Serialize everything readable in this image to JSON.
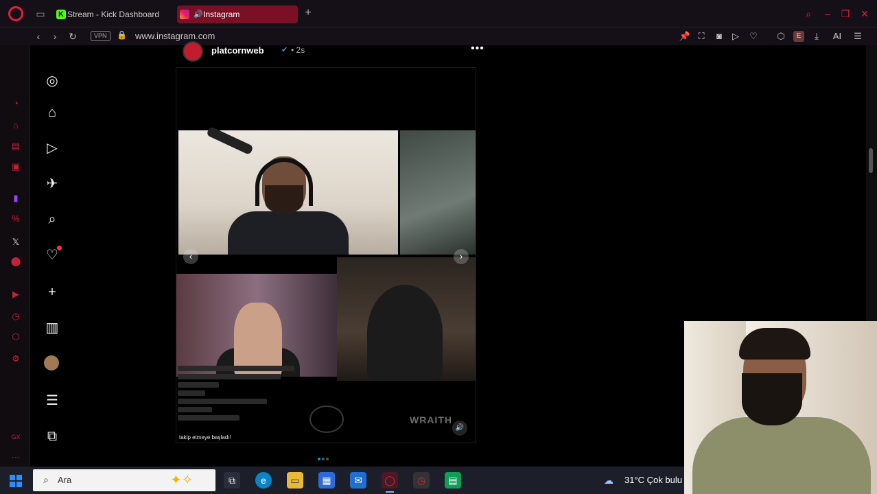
{
  "browser": {
    "tabs": [
      {
        "label": "Stream - Kick Dashboard",
        "active": false
      },
      {
        "label": "Instagram",
        "active": true
      }
    ],
    "vpn_label": "VPN",
    "url": "www.instagram.com",
    "ai_label": "AI",
    "ext_label": "E"
  },
  "sidebar": {
    "items": [
      "instagram-logo",
      "home",
      "reels",
      "messages",
      "search",
      "notifications",
      "create",
      "dashboard",
      "profile",
      "more",
      "also-from-meta"
    ]
  },
  "post": {
    "username": "platcornweb",
    "time": "2s",
    "chat_final": "takip etmeye başladı!",
    "watermark": "WRAITH",
    "carousel_count": 3,
    "carousel_active": 1
  },
  "taskbar": {
    "search_placeholder": "Ara",
    "weather_temp": "31°C",
    "weather_text": "Çok bulu"
  },
  "colors": {
    "accent": "#e0213e",
    "active_tab": "#7a0f25",
    "ig_blue": "#0095f6"
  }
}
